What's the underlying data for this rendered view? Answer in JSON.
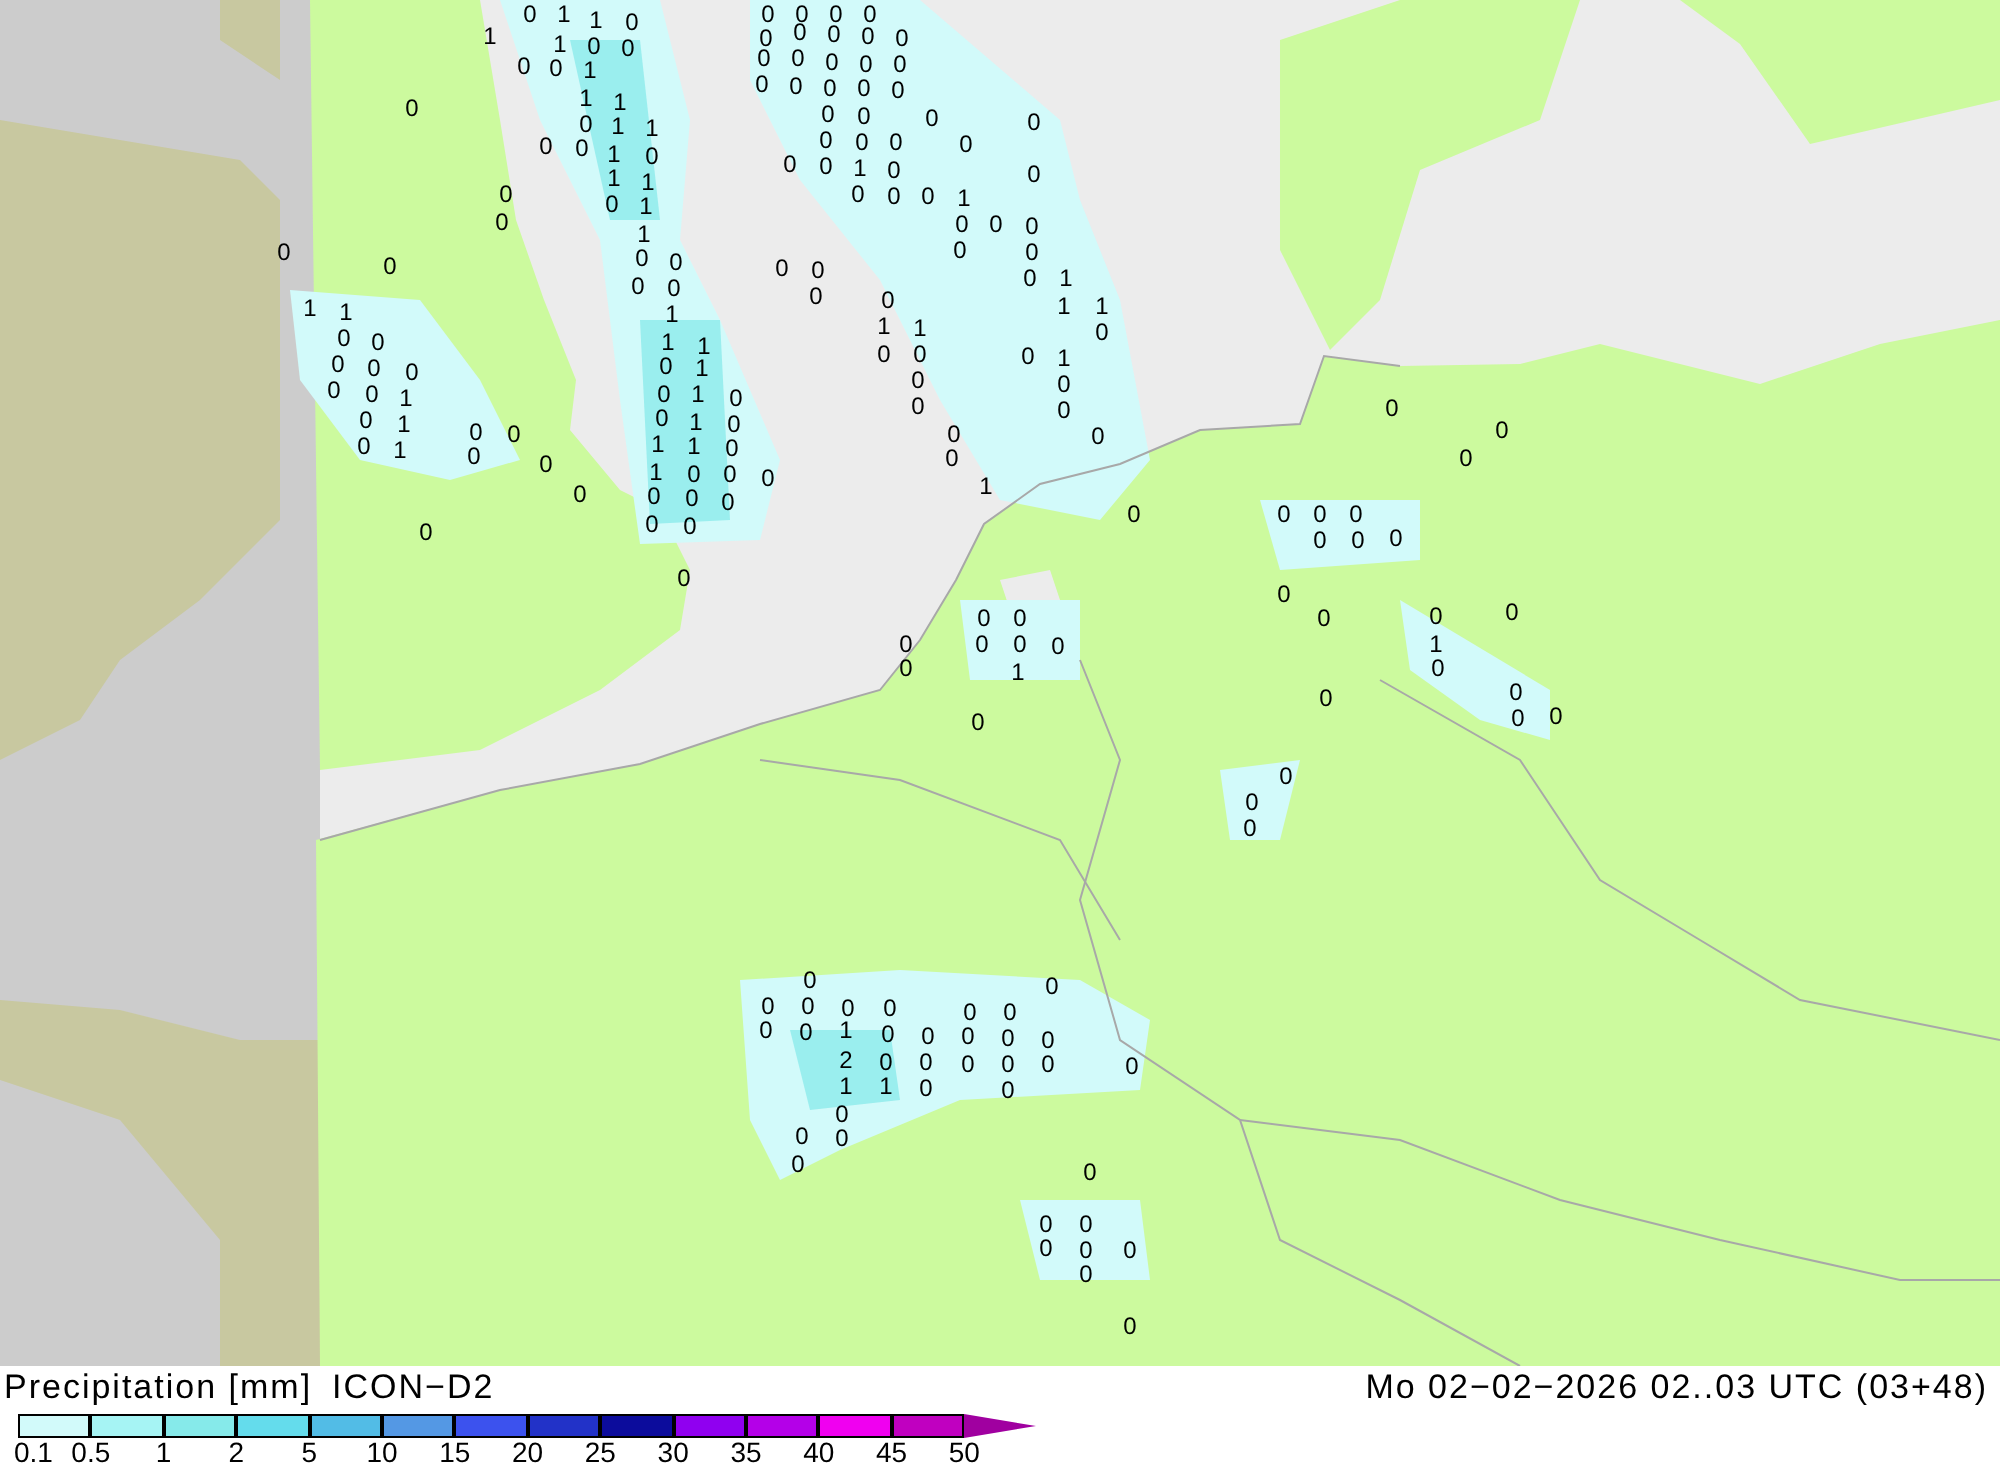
{
  "map": {
    "labels": [
      "1",
      "0",
      "1",
      "1",
      "0",
      "1",
      "0",
      "0",
      "0",
      "0",
      "1",
      "1",
      "1",
      "0",
      "1",
      "1",
      "0",
      "0",
      "1",
      "0",
      "1",
      "1",
      "0",
      "0",
      "1",
      "0",
      "1",
      "0",
      "0",
      "0",
      "0",
      "1",
      "1",
      "1",
      "0",
      "1",
      "0",
      "1",
      "0",
      "0",
      "1",
      "0",
      "1",
      "1",
      "0",
      "1",
      "0",
      "0",
      "0",
      "0",
      "0",
      "0",
      "0",
      "0",
      "0",
      "0",
      "0",
      "0",
      "0",
      "0",
      "0",
      "0",
      "0",
      "0",
      "0",
      "0",
      "0",
      "0",
      "0",
      "0",
      "0",
      "0",
      "0",
      "0",
      "0",
      "0",
      "0",
      "0",
      "0",
      "0",
      "0",
      "0",
      "0",
      "1",
      "0",
      "0",
      "0",
      "0",
      "0",
      "1",
      "0",
      "0",
      "0",
      "0",
      "0",
      "0",
      "0",
      "0",
      "1",
      "0",
      "0",
      "1",
      "1",
      "1",
      "1",
      "0",
      "0",
      "0",
      "0",
      "1",
      "0",
      "0",
      "0",
      "0",
      "0",
      "0",
      "0",
      "1",
      "0",
      "0",
      "0",
      "0",
      "1",
      "1",
      "0",
      "0",
      "0",
      "0",
      "0",
      "0",
      "0",
      "1",
      "0",
      "1",
      "0",
      "1",
      "0",
      "0",
      "0",
      "0",
      "0",
      "0",
      "0",
      "0",
      "0",
      "0",
      "0",
      "0",
      "0",
      "0",
      "0",
      "0",
      "0",
      "0",
      "0",
      "0",
      "1",
      "0",
      "0",
      "0",
      "0",
      "0",
      "0",
      "1",
      "0",
      "0",
      "0",
      "0",
      "0",
      "0",
      "0",
      "0",
      "0",
      "0",
      "0",
      "0",
      "0",
      "0",
      "0",
      "0",
      "0",
      "0",
      "0",
      "0",
      "1",
      "0",
      "0",
      "0",
      "0",
      "0",
      "2",
      "0",
      "0",
      "0",
      "0",
      "0",
      "0",
      "1",
      "1",
      "0",
      "0",
      "0",
      "0",
      "0",
      "0",
      "0",
      "0",
      "0",
      "0",
      "0",
      "0",
      "0",
      "0"
    ]
  },
  "legend": {
    "title": "Precipitation [mm]",
    "model": "ICON−D2",
    "valid_time": "Mo 02−02−2026 02..03 UTC (03+48)",
    "ticks": [
      "0.1",
      "0.5",
      "1",
      "2",
      "5",
      "10",
      "15",
      "20",
      "25",
      "30",
      "35",
      "40",
      "45",
      "50"
    ]
  }
}
